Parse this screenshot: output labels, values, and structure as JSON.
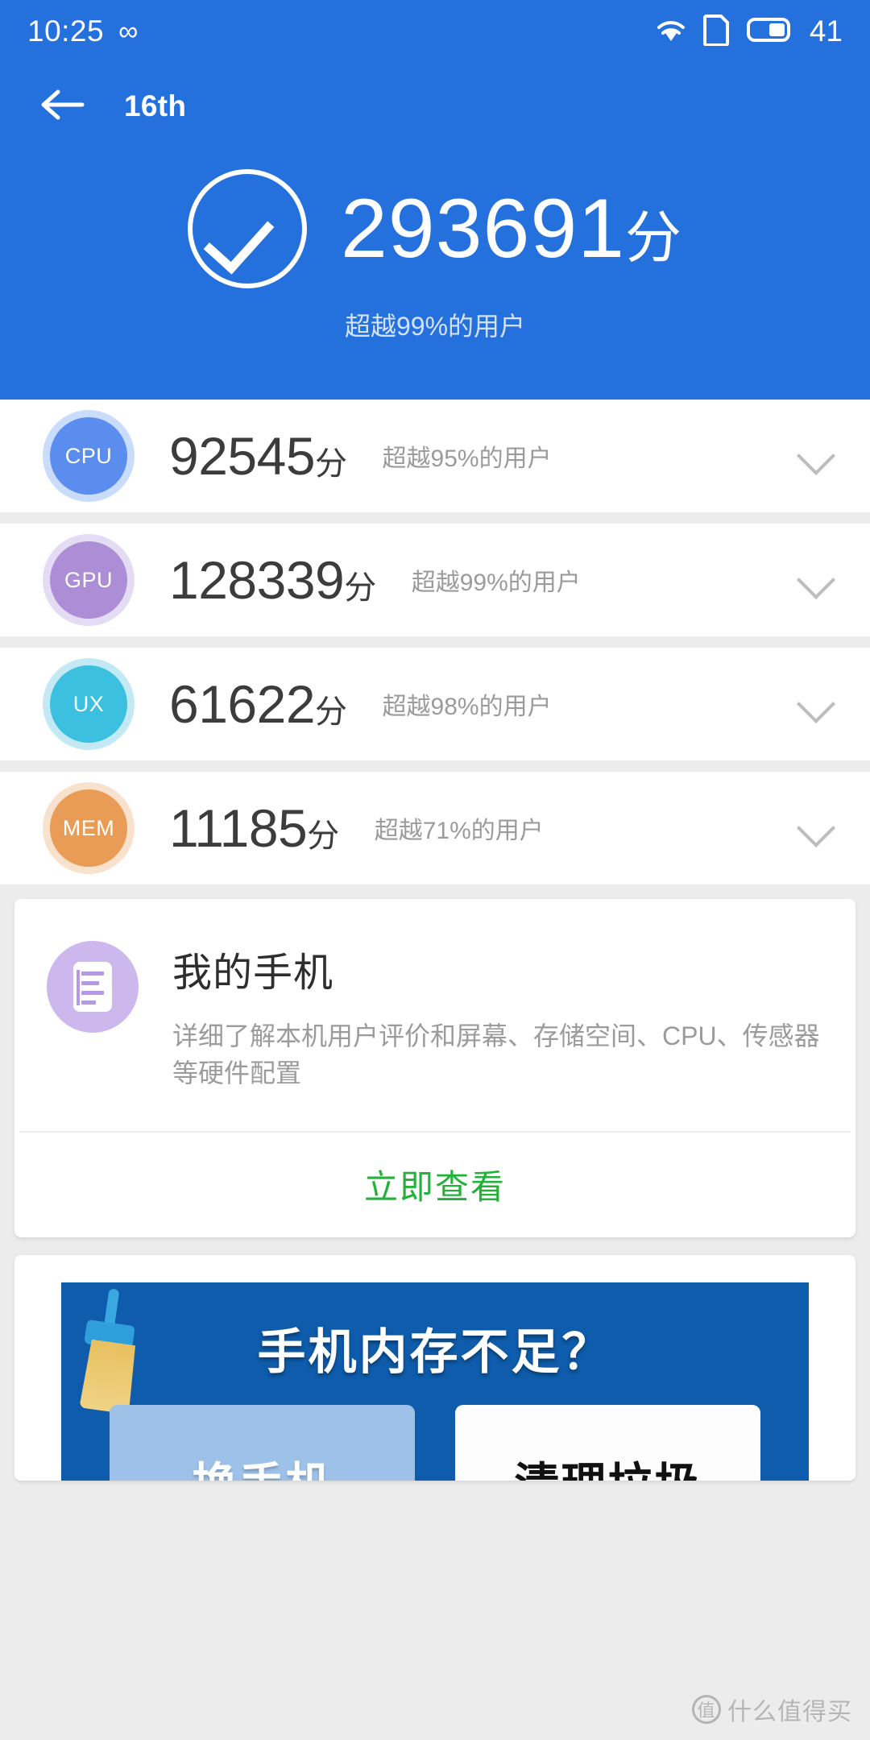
{
  "statusbar": {
    "time": "10:25",
    "infinity_icon": "infinity-icon",
    "wifi_icon": "wifi-icon",
    "sim_icon": "sim-card-icon",
    "battery_icon": "battery-icon",
    "battery_level": "41"
  },
  "appbar": {
    "back_icon": "back-arrow-icon",
    "title": "16th"
  },
  "hero": {
    "check_icon": "check-circle-icon",
    "score": "293691",
    "unit": "分",
    "subtitle": "超越99%的用户"
  },
  "scores": [
    {
      "key": "CPU",
      "score": "92545",
      "unit": "分",
      "subtitle": "超越95%的用户",
      "badge_color": "#5b8dee",
      "ring_color": "#c9dcfb",
      "chevron_icon": "chevron-down-icon"
    },
    {
      "key": "GPU",
      "score": "128339",
      "unit": "分",
      "subtitle": "超越99%的用户",
      "badge_color": "#ab8ed6",
      "ring_color": "#e4dbf4",
      "chevron_icon": "chevron-down-icon"
    },
    {
      "key": "UX",
      "score": "61622",
      "unit": "分",
      "subtitle": "超越98%的用户",
      "badge_color": "#3cc0e0",
      "ring_color": "#c3eaf4",
      "chevron_icon": "chevron-down-icon"
    },
    {
      "key": "MEM",
      "score": "11185",
      "unit": "分",
      "subtitle": "超越71%的用户",
      "badge_color": "#e89c55",
      "ring_color": "#f8e2cd",
      "chevron_icon": "chevron-down-icon"
    }
  ],
  "phone_card": {
    "icon": "document-icon",
    "title": "我的手机",
    "description": "详细了解本机用户评价和屏幕、存储空间、CPU、传感器等硬件配置",
    "action_label": "立即查看",
    "action_color": "#22b23a"
  },
  "ad": {
    "broom_icon": "broom-icon",
    "headline": "手机内存不足？",
    "left_label": "换手机",
    "left_mark_icon": "cross-mark-icon",
    "right_label": "清理垃圾",
    "right_mark_icon": "check-mark-icon",
    "background_color": "#0e5cab"
  },
  "watermark": {
    "logo": "值",
    "text": "什么值得买"
  },
  "theme": {
    "header_blue": "#2470dc",
    "page_background": "#ececec",
    "card_background": "#ffffff"
  }
}
